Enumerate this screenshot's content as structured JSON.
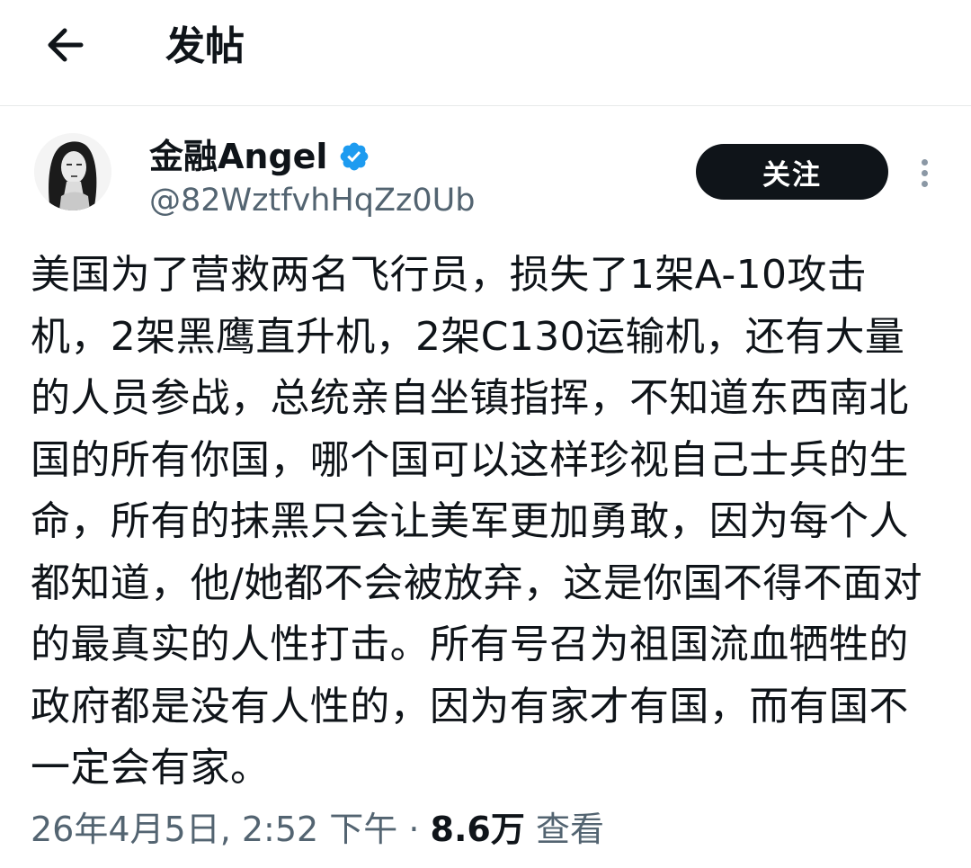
{
  "header": {
    "title": "发帖",
    "back_icon": "arrow-left-icon"
  },
  "author": {
    "display_name": "金融Angel",
    "handle": "@82WztfvhHqZz0Ub",
    "verified": true,
    "verified_icon": "verified-badge-icon",
    "verified_color": "#1d9bf0"
  },
  "actions": {
    "follow_label": "关注",
    "more_icon": "more-vertical-icon"
  },
  "post": {
    "text": "美国为了营救两名飞行员，损失了1架A-10攻击机，2架黑鹰直升机，2架C130运输机，还有大量的人员参战，总统亲自坐镇指挥，不知道东西南北国的所有你国，哪个国可以这样珍视自己士兵的生命，所有的抹黑只会让美军更加勇敢，因为每个人都知道，他/她都不会被放弃，这是你国不得不面对的最真实的人性打击。所有号召为祖国流血牺牲的政府都是没有人性的，因为有家才有国，而有国不一定会有家。"
  },
  "meta": {
    "timestamp": "26年4月5日, 2:52 下午",
    "separator": " · ",
    "views_count": "8.6万",
    "views_label": " 查看"
  },
  "colors": {
    "text_primary": "#0f1419",
    "text_secondary": "#536471",
    "divider": "#e7e9ea",
    "button_bg": "#0f1419"
  }
}
